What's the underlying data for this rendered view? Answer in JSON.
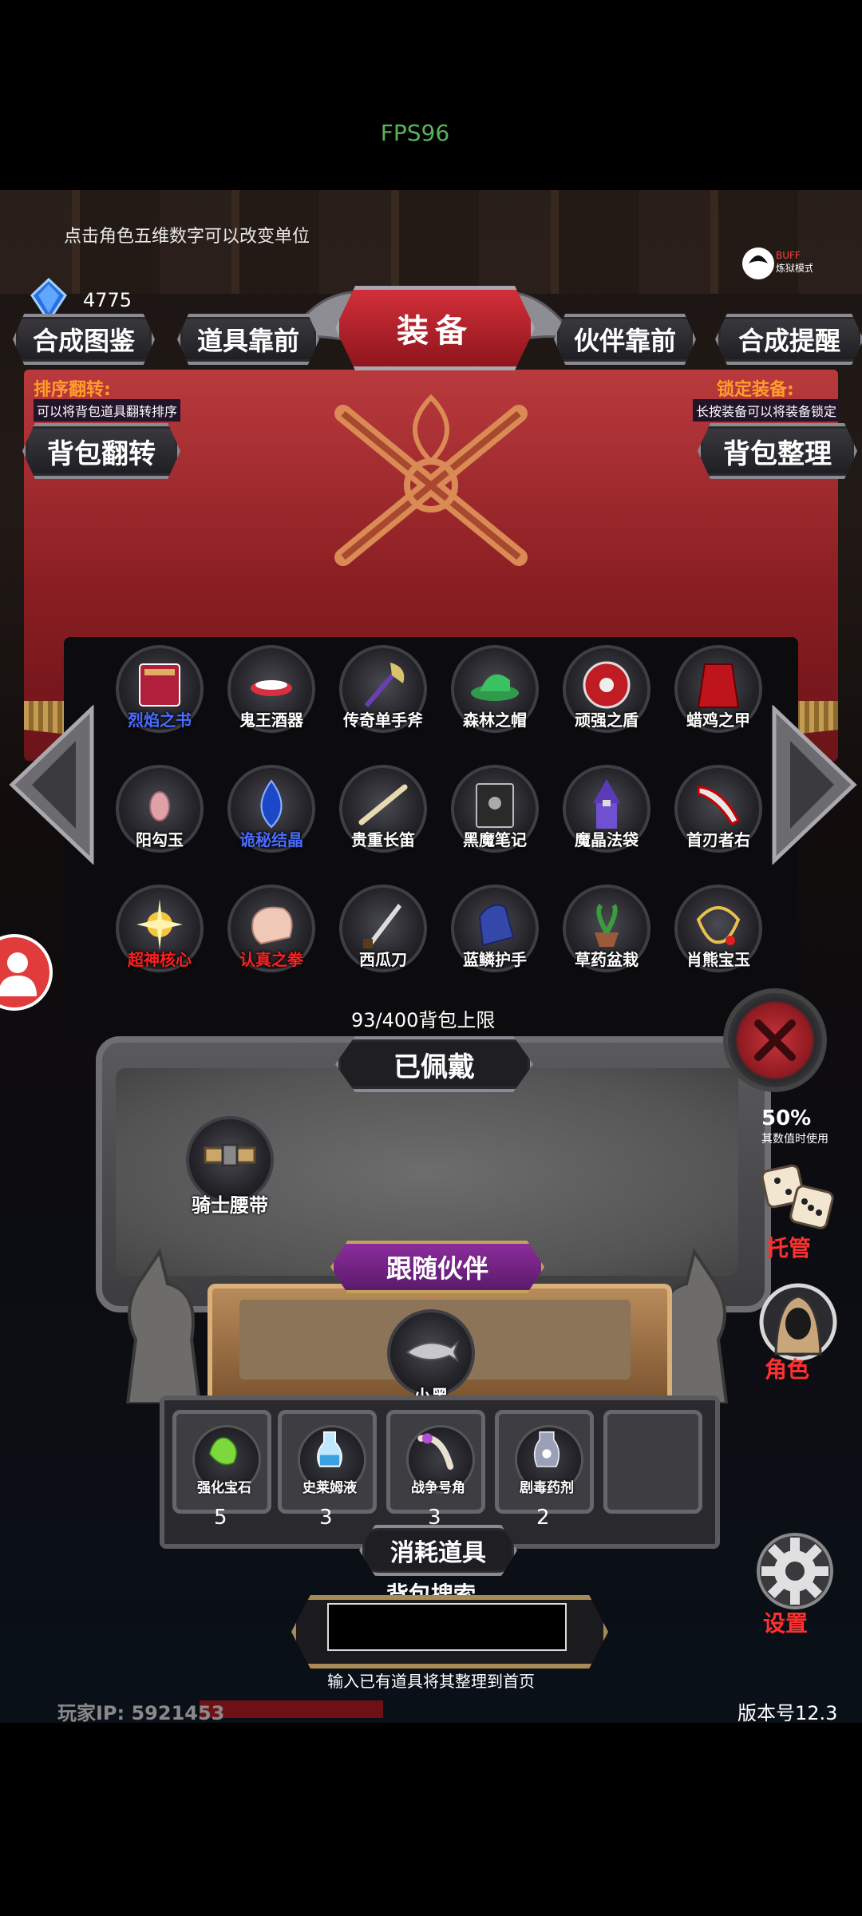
{
  "status": {
    "fps": "FPS96"
  },
  "top": {
    "hint": "点击角色五维数字可以改变单位",
    "gem_count": "4775",
    "buff_label": "BUFF",
    "buff_mode": "炼狱模式"
  },
  "tabs": {
    "synth_guide": "合成图鉴",
    "items_front": "道具靠前",
    "title": "装备",
    "partner_front": "伙伴靠前",
    "synth_remind": "合成提醒"
  },
  "sort_info": {
    "title": "排序翻转:",
    "desc": "可以将背包道具翻转排序",
    "button": "背包翻转"
  },
  "lock_info": {
    "title": "锁定装备:",
    "desc": "长按装备可以将装备锁定",
    "button": "背包整理"
  },
  "inventory": {
    "items": [
      {
        "name": "烈焰之书",
        "color": "#4a6cff",
        "icon": "book-icon"
      },
      {
        "name": "鬼王酒器",
        "color": "#ffffff",
        "icon": "bowl-icon"
      },
      {
        "name": "传奇单手斧",
        "color": "#ffffff",
        "icon": "axe-icon"
      },
      {
        "name": "森林之帽",
        "color": "#ffffff",
        "icon": "hat-icon"
      },
      {
        "name": "顽强之盾",
        "color": "#ffffff",
        "icon": "shield-icon"
      },
      {
        "name": "蜡鸡之甲",
        "color": "#ffffff",
        "icon": "cloak-icon"
      },
      {
        "name": "阳勾玉",
        "color": "#ffffff",
        "icon": "jade-icon"
      },
      {
        "name": "诡秘结晶",
        "color": "#4a6cff",
        "icon": "crystal-icon"
      },
      {
        "name": "贵重长笛",
        "color": "#ffffff",
        "icon": "flute-icon"
      },
      {
        "name": "黑魔笔记",
        "color": "#ffffff",
        "icon": "notebook-icon"
      },
      {
        "name": "魔晶法袋",
        "color": "#ffffff",
        "icon": "wizard-icon"
      },
      {
        "name": "首刃者右",
        "color": "#ffffff",
        "icon": "blade-icon"
      },
      {
        "name": "超神核心",
        "color": "#ff2020",
        "icon": "core-icon"
      },
      {
        "name": "认真之拳",
        "color": "#ff2020",
        "icon": "fist-icon"
      },
      {
        "name": "西瓜刀",
        "color": "#ffffff",
        "icon": "knife-icon"
      },
      {
        "name": "蓝鳞护手",
        "color": "#ffffff",
        "icon": "gauntlet-icon"
      },
      {
        "name": "草药盆栽",
        "color": "#ffffff",
        "icon": "plant-icon"
      },
      {
        "name": "肖熊宝玉",
        "color": "#ffffff",
        "icon": "pendant-icon"
      }
    ],
    "limit": "93/400背包上限"
  },
  "equipped": {
    "title": "已佩戴",
    "belt": "骑士腰带"
  },
  "partner": {
    "title": "跟随伙伴",
    "pet": "小黑"
  },
  "consumables": {
    "title": "消耗道具",
    "slots": [
      {
        "name": "强化宝石",
        "count": "5"
      },
      {
        "name": "史莱姆液",
        "count": "3"
      },
      {
        "name": "战争号角",
        "count": "3"
      },
      {
        "name": "剧毒药剂",
        "count": "2"
      }
    ]
  },
  "search": {
    "title": "背包搜索",
    "value": "",
    "tip": "输入已有道具将其整理到首页"
  },
  "side": {
    "stat_pct": "50%",
    "stat_note": "其数值时使用",
    "dice_label": "托管",
    "role_label": "角色",
    "settings_label": "设置"
  },
  "footer": {
    "player_ip": "玩家IP:  5921453",
    "version": "版本号12.3"
  },
  "colors": {
    "accent_red": "#ff3030",
    "label_orange": "#ff9d2b",
    "rare_blue": "#4a6cff",
    "fps_green": "#58b45a"
  }
}
